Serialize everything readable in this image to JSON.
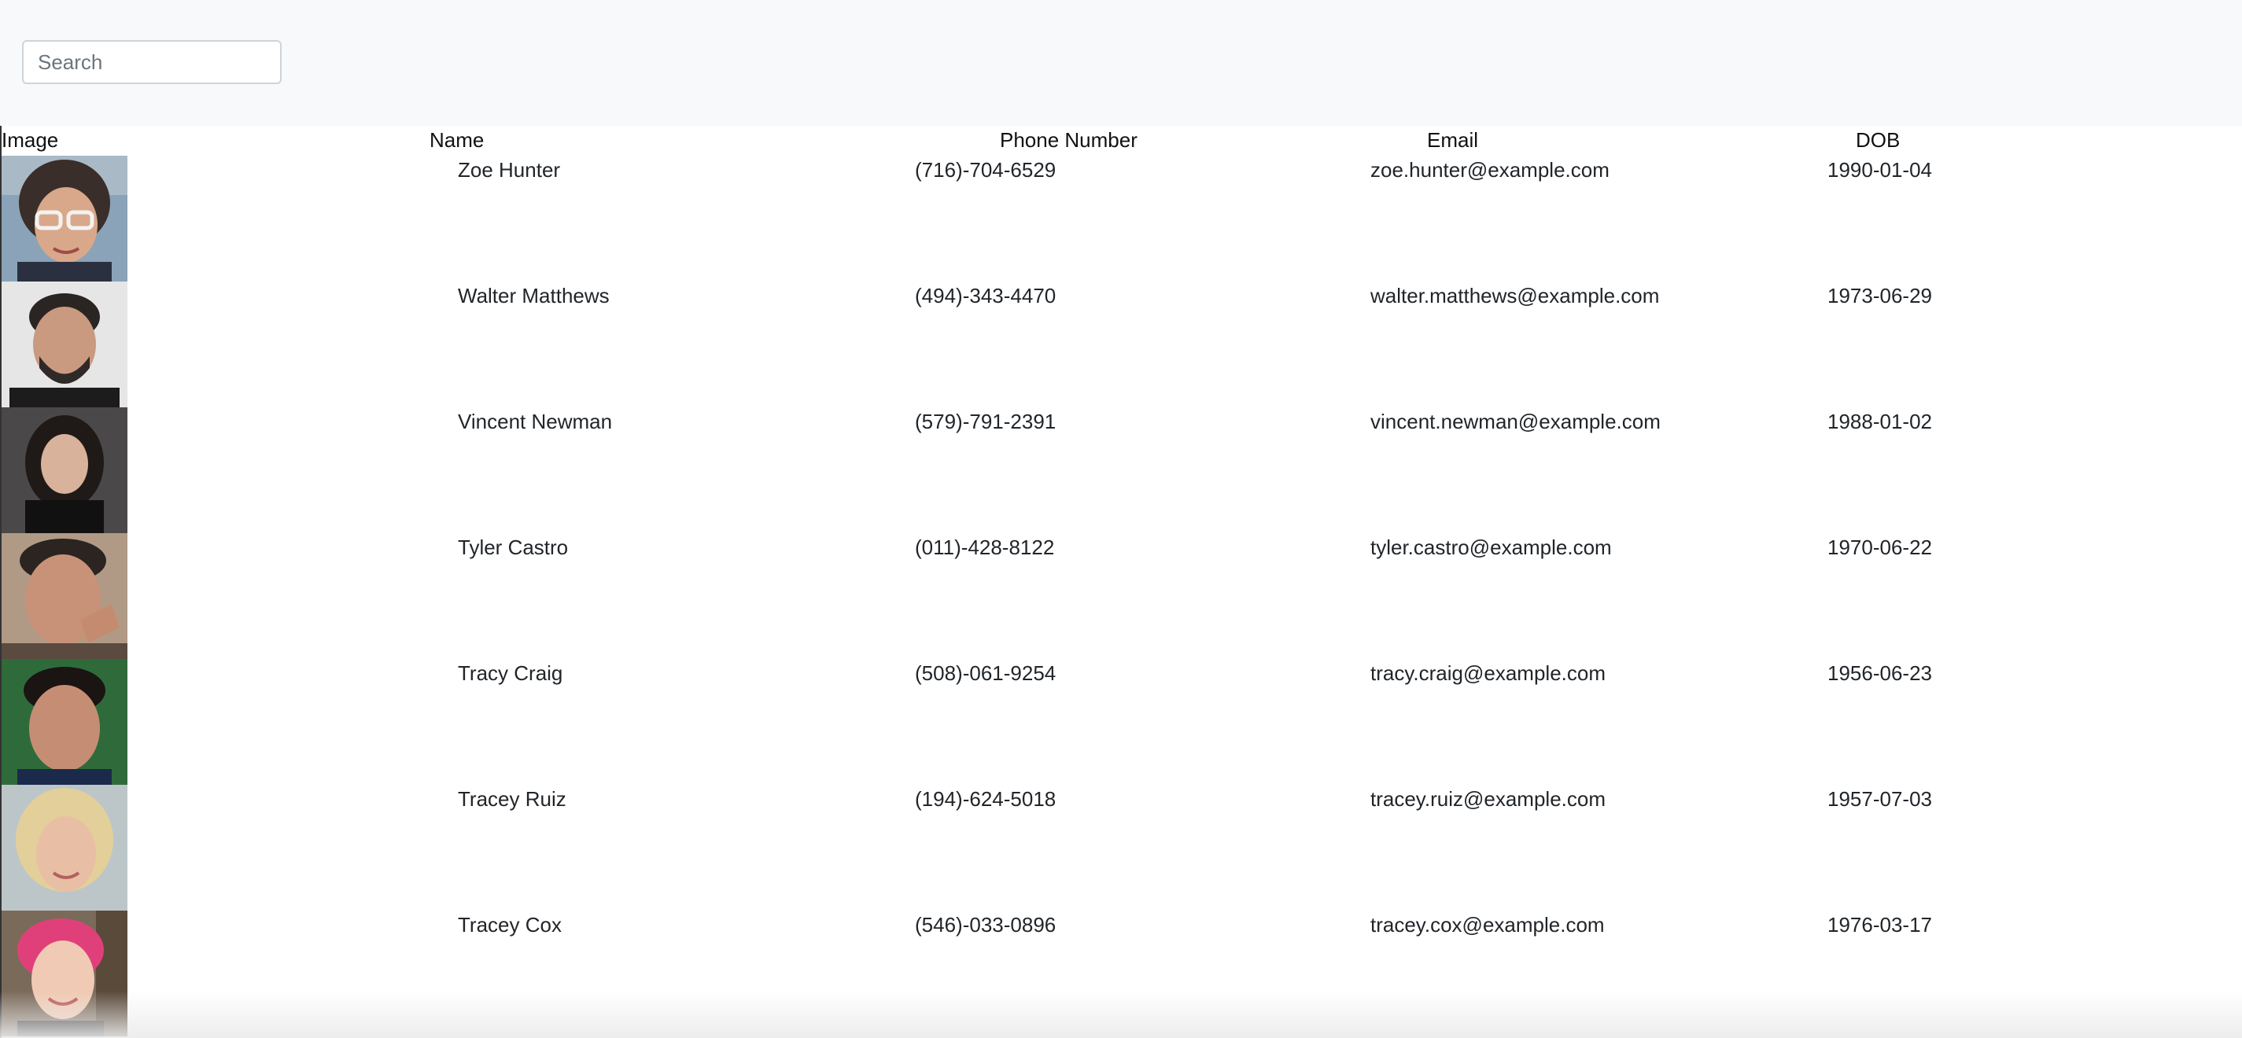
{
  "search": {
    "placeholder": "Search"
  },
  "table": {
    "headers": {
      "image": "Image",
      "name": "Name",
      "phone": "Phone Number",
      "email": "Email",
      "dob": "DOB"
    },
    "rows": [
      {
        "name": "Zoe Hunter",
        "phone": "(716)-704-6529",
        "email": "zoe.hunter@example.com",
        "dob": "1990-01-04"
      },
      {
        "name": "Walter Matthews",
        "phone": "(494)-343-4470",
        "email": "walter.matthews@example.com",
        "dob": "1973-06-29"
      },
      {
        "name": "Vincent Newman",
        "phone": "(579)-791-2391",
        "email": "vincent.newman@example.com",
        "dob": "1988-01-02"
      },
      {
        "name": "Tyler Castro",
        "phone": "(011)-428-8122",
        "email": "tyler.castro@example.com",
        "dob": "1970-06-22"
      },
      {
        "name": "Tracy Craig",
        "phone": "(508)-061-9254",
        "email": "tracy.craig@example.com",
        "dob": "1956-06-23"
      },
      {
        "name": "Tracey Ruiz",
        "phone": "(194)-624-5018",
        "email": "tracey.ruiz@example.com",
        "dob": "1957-07-03"
      },
      {
        "name": "Tracey Cox",
        "phone": "(546)-033-0896",
        "email": "tracey.cox@example.com",
        "dob": "1976-03-17"
      }
    ]
  },
  "colors": {
    "topbar_bg": "#f8f9fa",
    "text": "#212529",
    "input_border": "#ced4da"
  }
}
